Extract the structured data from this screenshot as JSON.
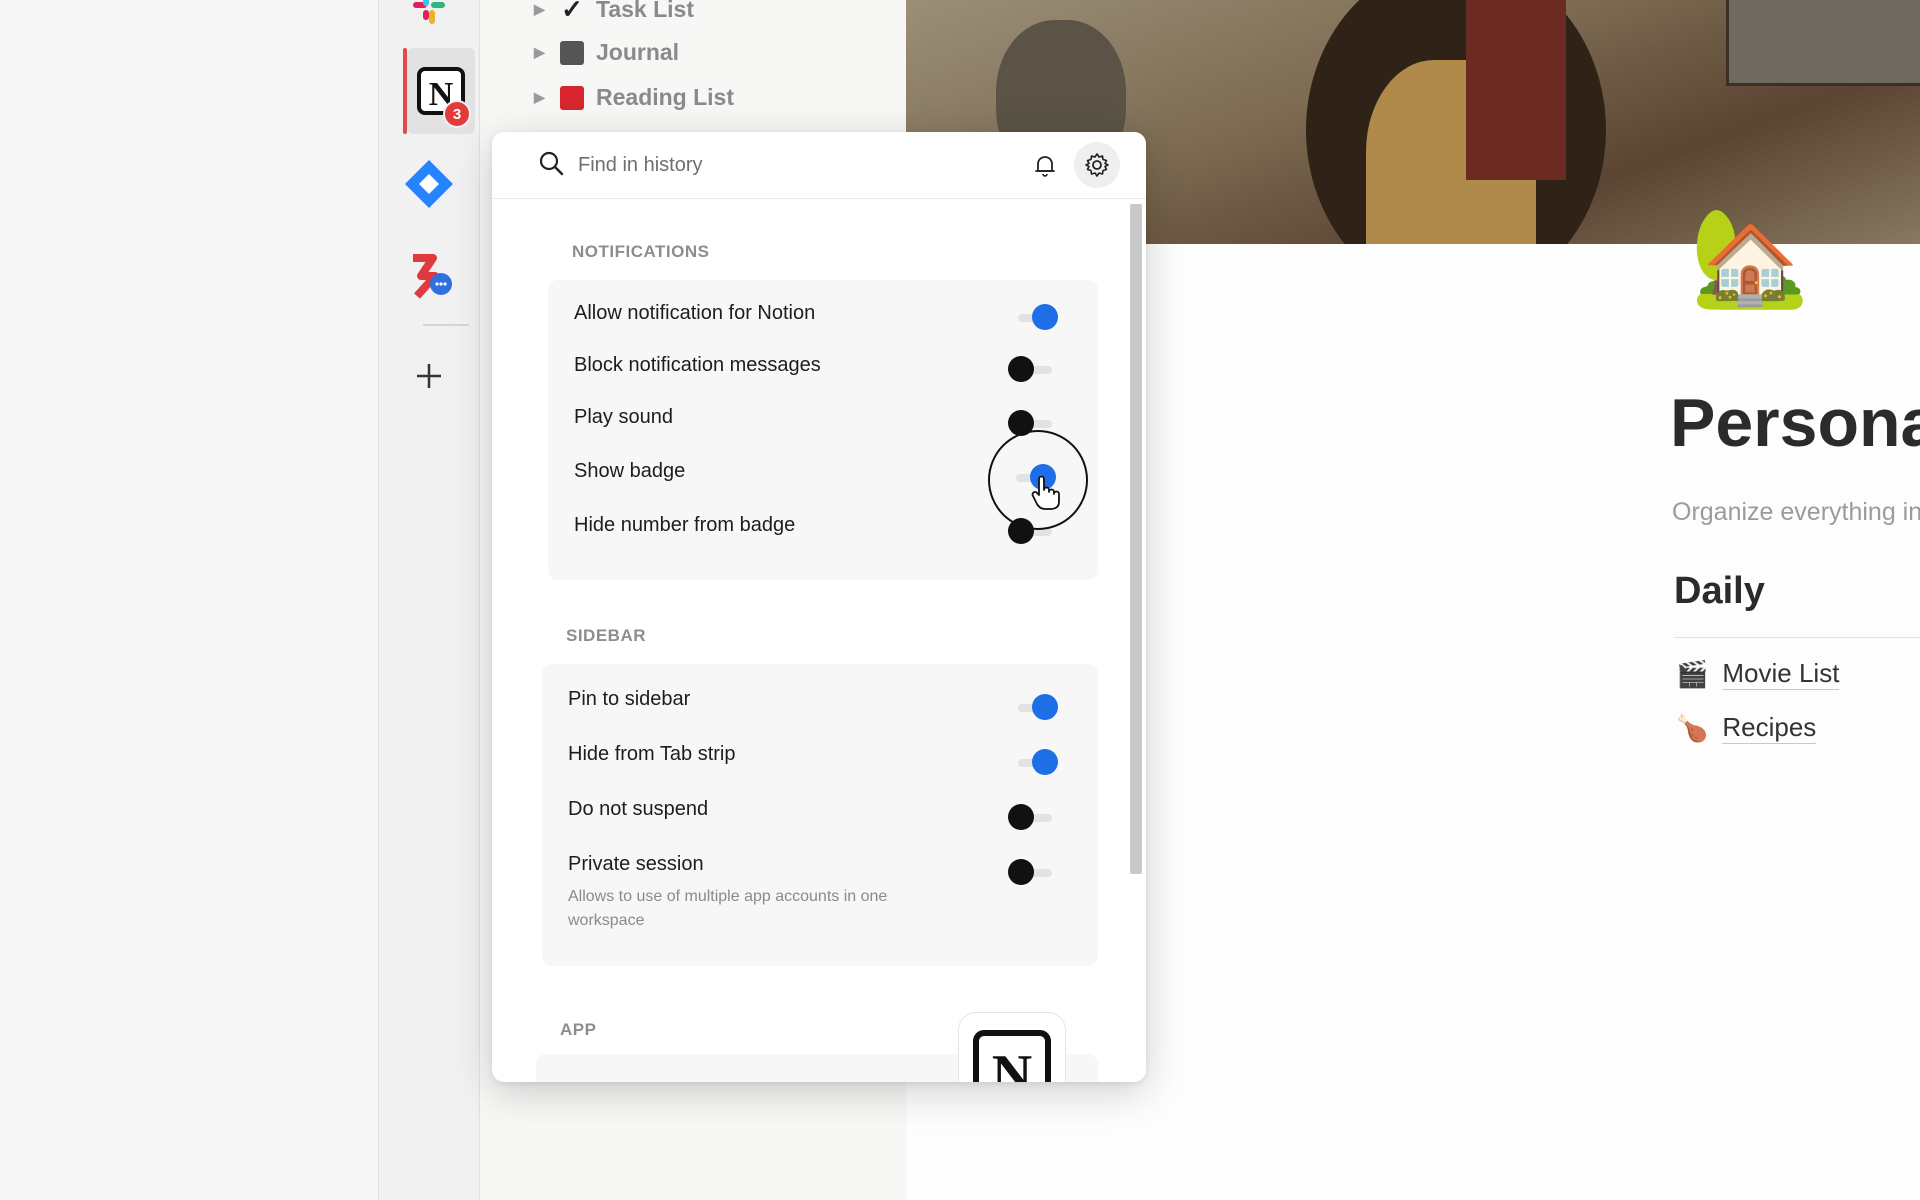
{
  "dock": {
    "notion_badge": "3",
    "apps": [
      "slack-icon",
      "notion-icon",
      "jira-icon",
      "chat-app-icon"
    ],
    "add": "plus-icon"
  },
  "tree": {
    "items": [
      {
        "label": "Task List",
        "icon": "checkmark-icon"
      },
      {
        "label": "Journal",
        "icon": "book-icon"
      },
      {
        "label": "Reading List",
        "icon": "red-book-icon"
      }
    ]
  },
  "page": {
    "title": "Persona",
    "subtitle": "Organize everything in",
    "section": "Daily",
    "links": [
      {
        "label": "Movie List",
        "icon": "🎬"
      },
      {
        "label": "Recipes",
        "icon": "🍗"
      }
    ],
    "icon": "🏡"
  },
  "popup": {
    "search_placeholder": "Find in history",
    "notifications": {
      "title": "NOTIFICATIONS",
      "rows": [
        {
          "label": "Allow notification for Notion",
          "on": true
        },
        {
          "label": "Block notification messages",
          "on": false
        },
        {
          "label": "Play sound",
          "on": false
        },
        {
          "label": "Show badge",
          "on": true
        },
        {
          "label": "Hide number from badge",
          "on": false
        }
      ]
    },
    "sidebar": {
      "title": "SIDEBAR",
      "rows": [
        {
          "label": "Pin to sidebar",
          "on": true
        },
        {
          "label": "Hide from Tab strip",
          "on": true
        },
        {
          "label": "Do not suspend",
          "on": false
        },
        {
          "label": "Private session",
          "on": false,
          "desc": "Allows to use of multiple app accounts in one workspace"
        }
      ]
    },
    "app": {
      "title": "APP"
    }
  },
  "colors": {
    "toggle_on": "#1e6ee8",
    "toggle_off": "#111111",
    "badge": "#e23b3b"
  }
}
